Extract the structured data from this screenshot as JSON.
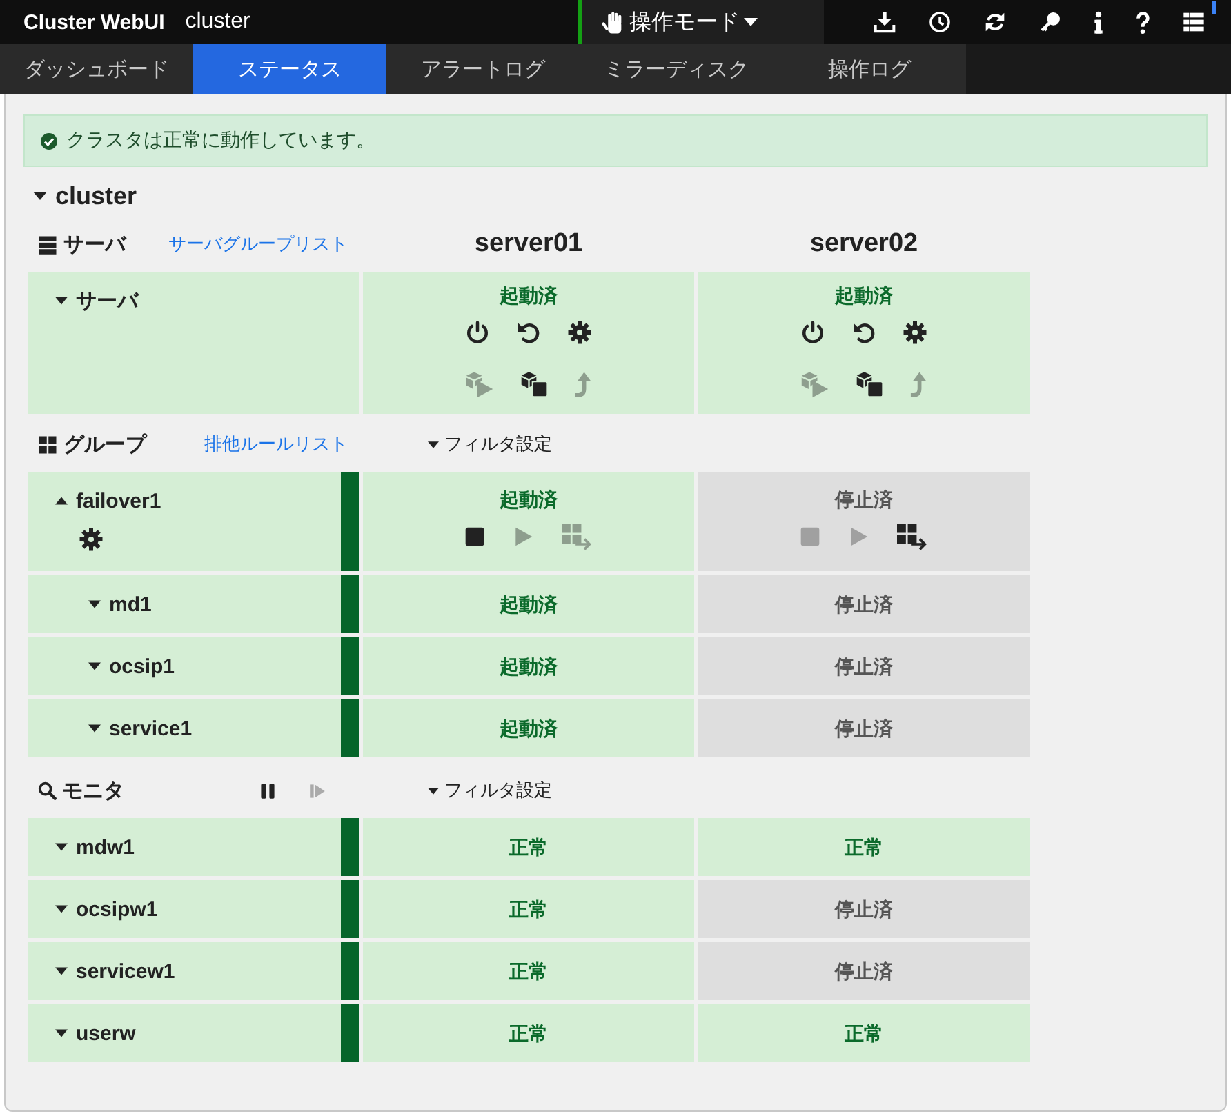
{
  "header": {
    "title": "Cluster WebUI",
    "cluster": "cluster",
    "mode": "操作モード"
  },
  "tabs": [
    {
      "label": "ダッシュボード",
      "selected": false
    },
    {
      "label": "ステータス",
      "selected": true
    },
    {
      "label": "アラートログ",
      "selected": false
    },
    {
      "label": "ミラーディスク",
      "selected": false
    },
    {
      "label": "操作ログ",
      "selected": false
    }
  ],
  "alert": {
    "message": "クラスタは正常に動作しています。"
  },
  "cluster": {
    "name": "cluster",
    "expanded": true
  },
  "servers": {
    "title": "サーバ",
    "link": "サーバグループリスト",
    "columns": [
      "server01",
      "server02"
    ],
    "rows": [
      {
        "name": "サーバ",
        "expanded": false,
        "cells": [
          {
            "status": "起動済",
            "active": true,
            "action_rows": [
              [
                {
                  "kind": "power",
                  "disabled": false
                },
                {
                  "kind": "restart",
                  "disabled": false
                },
                {
                  "kind": "settings",
                  "disabled": false
                }
              ],
              [
                {
                  "kind": "cube-start",
                  "disabled": true
                },
                {
                  "kind": "cubes",
                  "disabled": false
                },
                {
                  "kind": "lift",
                  "disabled": true
                }
              ]
            ]
          },
          {
            "status": "起動済",
            "active": true,
            "action_rows": [
              [
                {
                  "kind": "power",
                  "disabled": false
                },
                {
                  "kind": "restart",
                  "disabled": false
                },
                {
                  "kind": "settings",
                  "disabled": false
                }
              ],
              [
                {
                  "kind": "cube-start",
                  "disabled": true
                },
                {
                  "kind": "cubes",
                  "disabled": false
                },
                {
                  "kind": "lift",
                  "disabled": true
                }
              ]
            ]
          }
        ]
      }
    ]
  },
  "groups": {
    "title": "グループ",
    "link": "排他ルールリスト",
    "filter": "フィルタ設定",
    "rows": [
      {
        "name": "failover1",
        "expanded": true,
        "color": "#05652a",
        "name_actions": [
          {
            "kind": "settings",
            "disabled": false
          }
        ],
        "cells": [
          {
            "status": "起動済",
            "active": true,
            "actions": [
              {
                "kind": "stop",
                "disabled": false
              },
              {
                "kind": "start",
                "disabled": true
              },
              {
                "kind": "move",
                "disabled": true
              }
            ]
          },
          {
            "status": "停止済",
            "active": false,
            "actions": [
              {
                "kind": "stop",
                "disabled": true
              },
              {
                "kind": "start",
                "disabled": true
              },
              {
                "kind": "move",
                "disabled": false
              }
            ]
          }
        ],
        "children": [
          {
            "name": "md1",
            "expanded": false,
            "color": "#05652a",
            "cells": [
              {
                "status": "起動済",
                "active": true
              },
              {
                "status": "停止済",
                "active": false
              }
            ]
          },
          {
            "name": "ocsip1",
            "expanded": false,
            "color": "#05652a",
            "cells": [
              {
                "status": "起動済",
                "active": true
              },
              {
                "status": "停止済",
                "active": false
              }
            ]
          },
          {
            "name": "service1",
            "expanded": false,
            "color": "#05652a",
            "cells": [
              {
                "status": "起動済",
                "active": true
              },
              {
                "status": "停止済",
                "active": false
              }
            ]
          }
        ]
      }
    ]
  },
  "monitors": {
    "title": "モニタ",
    "controls": [
      {
        "kind": "pause",
        "disabled": false
      },
      {
        "kind": "resume",
        "disabled": true
      }
    ],
    "filter": "フィルタ設定",
    "rows": [
      {
        "name": "mdw1",
        "expanded": false,
        "color": "#05652a",
        "cells": [
          {
            "status": "正常",
            "active": true
          },
          {
            "status": "正常",
            "active": true
          }
        ]
      },
      {
        "name": "ocsipw1",
        "expanded": false,
        "color": "#05652a",
        "cells": [
          {
            "status": "正常",
            "active": true
          },
          {
            "status": "停止済",
            "active": false
          }
        ]
      },
      {
        "name": "servicew1",
        "expanded": false,
        "color": "#05652a",
        "cells": [
          {
            "status": "正常",
            "active": true
          },
          {
            "status": "停止済",
            "active": false
          }
        ]
      },
      {
        "name": "userw",
        "expanded": false,
        "color": "#05652a",
        "cells": [
          {
            "status": "正常",
            "active": true
          },
          {
            "status": "正常",
            "active": true
          }
        ]
      }
    ]
  }
}
